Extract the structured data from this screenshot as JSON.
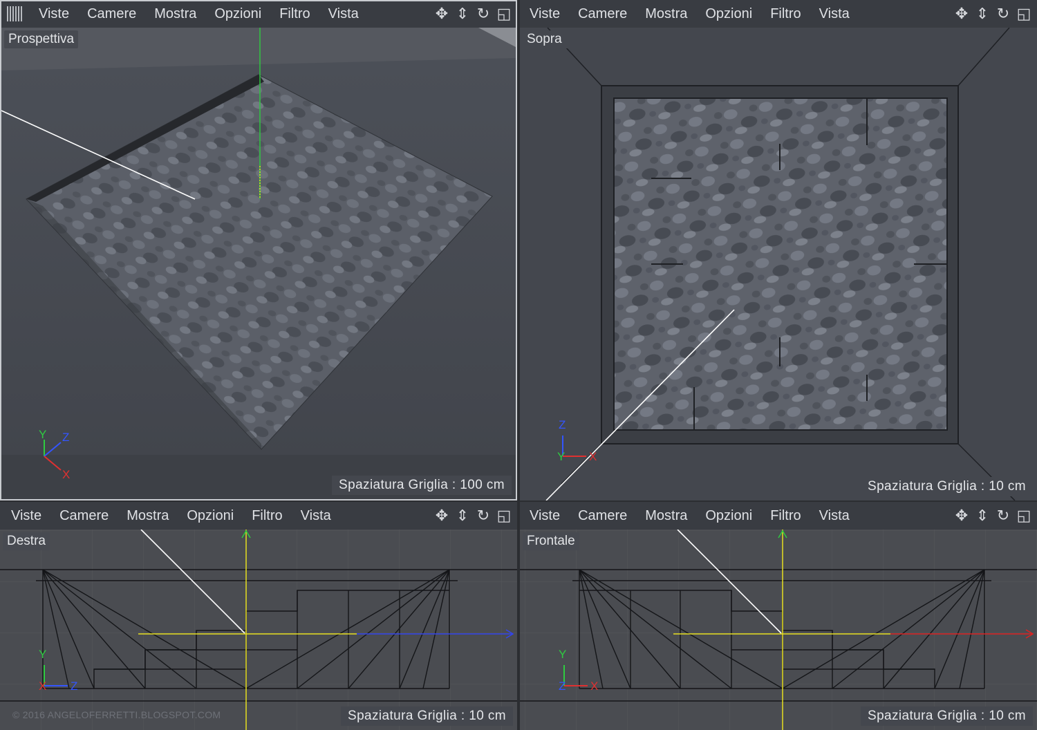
{
  "menu": [
    "Viste",
    "Camere",
    "Mostra",
    "Opzioni",
    "Filtro",
    "Vista"
  ],
  "nav_icons": [
    "move-icon",
    "zoom-icon",
    "rotate-icon",
    "maximize-icon"
  ],
  "nav_glyphs": [
    "✥",
    "⇕",
    "↻",
    "◱"
  ],
  "viewports": {
    "top_left": {
      "label": "Prospettiva",
      "grid": "Spaziatura Griglia : 100 cm"
    },
    "top_right": {
      "label": "Sopra",
      "grid": "Spaziatura Griglia : 10 cm"
    },
    "bottom_left": {
      "label": "Destra",
      "grid": "Spaziatura Griglia : 10 cm"
    },
    "bottom_right": {
      "label": "Frontale",
      "grid": "Spaziatura Griglia : 10 cm"
    }
  },
  "axes": {
    "x": "X",
    "y": "Y",
    "z": "Z"
  },
  "colors": {
    "x_axis": "#e03030",
    "y_axis": "#2ecc40",
    "z_axis": "#3355ff",
    "world_axis": "#e8e020"
  },
  "watermark": "© 2016 ANGELOFERRETTI.BLOGSPOT.COM"
}
